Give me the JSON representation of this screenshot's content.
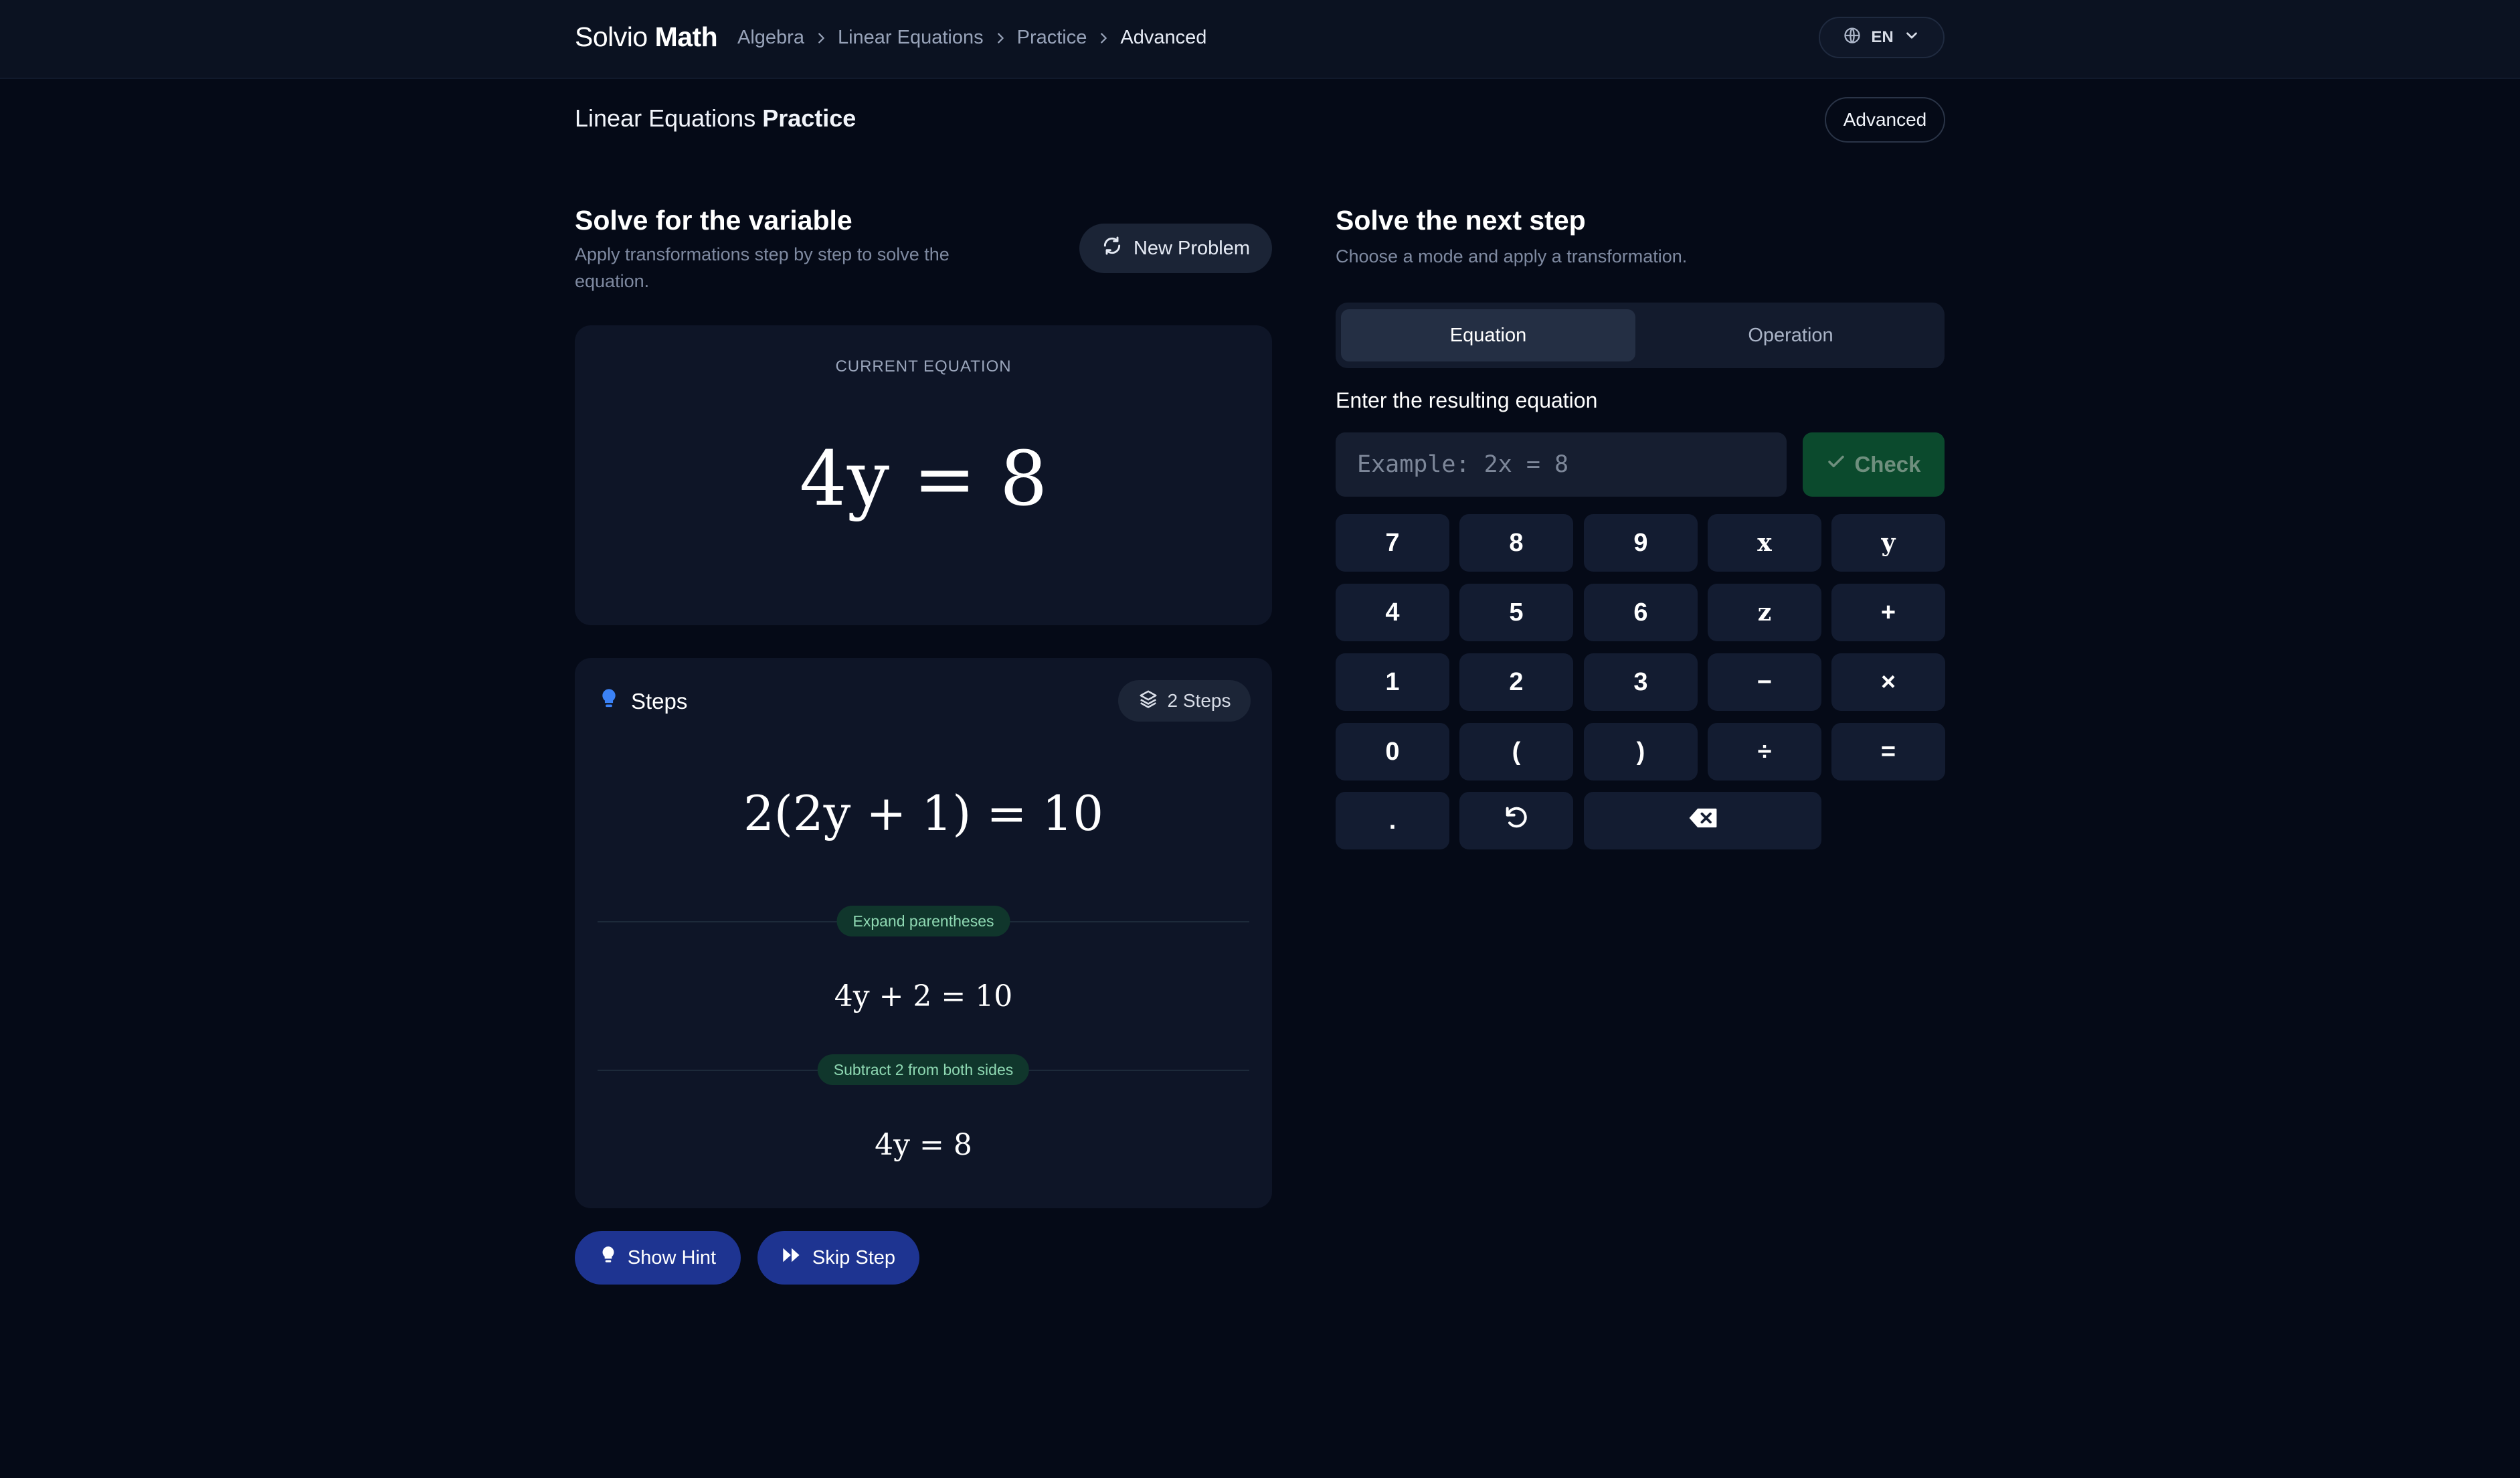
{
  "brand": {
    "light": "Solvio",
    "bold": "Math"
  },
  "breadcrumb": [
    "Algebra",
    "Linear Equations",
    "Practice",
    "Advanced"
  ],
  "language": "EN",
  "page": {
    "title_light": "Linear Equations",
    "title_bold": "Practice",
    "level": "Advanced"
  },
  "left": {
    "heading": "Solve for the variable",
    "subheading": "Apply transformations step by step to solve the equation.",
    "new_problem_label": "New Problem",
    "current_equation_label": "CURRENT EQUATION",
    "current_equation": "4y = 8"
  },
  "steps": {
    "title": "Steps",
    "count_label": "2 Steps",
    "original": "2(2y + 1) = 10",
    "items": [
      {
        "label": "Expand parentheses",
        "result": "4y + 2 = 10"
      },
      {
        "label": "Subtract 2 from both sides",
        "result": "4y = 8"
      }
    ]
  },
  "actions": {
    "hint_label": "Show Hint",
    "skip_label": "Skip Step"
  },
  "right": {
    "heading": "Solve the next step",
    "subheading": "Choose a mode and apply a transformation.",
    "modes": [
      "Equation",
      "Operation"
    ],
    "active_mode": "Equation",
    "input_label": "Enter the resulting equation",
    "input_placeholder": "Example: 2x = 8",
    "input_value": "",
    "check_label": "Check"
  },
  "keypad": [
    "7",
    "8",
    "9",
    "x",
    "y",
    "4",
    "5",
    "6",
    "z",
    "+",
    "1",
    "2",
    "3",
    "−",
    "×",
    "0",
    "(",
    ")",
    "÷",
    "=",
    "."
  ],
  "keypad_icons": [
    "undo-icon",
    "backspace-icon"
  ],
  "colors": {
    "background": "#050a17",
    "card": "#0e1527",
    "accent_blue": "#1e3491",
    "success_green": "#0b4a2d",
    "pill_green_text": "#8fd9b3"
  }
}
